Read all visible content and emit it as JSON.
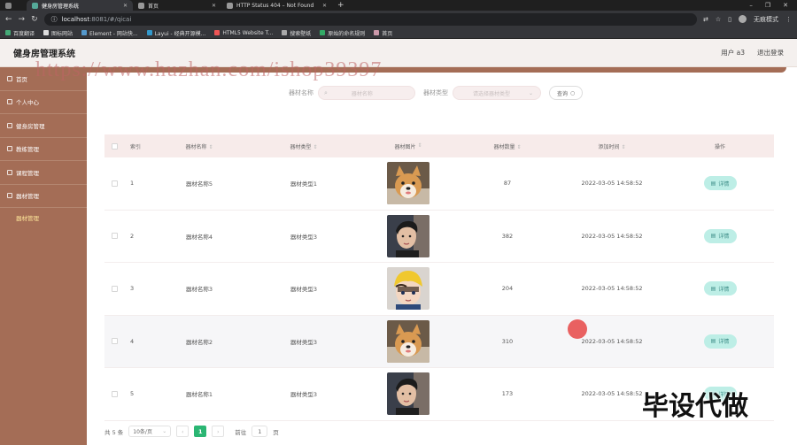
{
  "browser": {
    "tabs": [
      {
        "title": "健身房管理系统"
      },
      {
        "title": "首页"
      },
      {
        "title": "HTTP Status 404 – Not Found"
      }
    ],
    "url_host": "localhost",
    "url_rest": ":8081/#/qicai",
    "profile_label": "无痕模式",
    "bookmarks": [
      "百度翻译",
      "图标网站",
      "Element - 网站快...",
      "Layui - 经典开源模...",
      "HTML5 Website T...",
      "搜索壁纸",
      "原始的命名规则",
      "首页"
    ]
  },
  "header": {
    "title": "健身房管理系统",
    "user": "用户 a3",
    "logout": "退出登录"
  },
  "sidebar": {
    "items": [
      {
        "label": "首页"
      },
      {
        "label": "个人中心"
      },
      {
        "label": "健身房管理"
      },
      {
        "label": "教练管理"
      },
      {
        "label": "课程管理"
      },
      {
        "label": "器材管理"
      }
    ],
    "sub_item": "器材管理"
  },
  "search": {
    "name_label": "器材名称",
    "name_placeholder": "器材名称",
    "type_label": "器材类型",
    "type_placeholder": "请选择器材类型",
    "button": "查询"
  },
  "table": {
    "headers": {
      "index": "索引",
      "name": "器材名称",
      "type": "器材类型",
      "image": "器材图片",
      "count": "器材数量",
      "time": "添加时间",
      "op": "操作"
    },
    "detail_label": "详情",
    "rows": [
      {
        "index": "1",
        "name": "器材名称5",
        "type": "器材类型1",
        "image": "shiba-dog-photo",
        "count": "87",
        "time": "2022-03-05 14:58:52"
      },
      {
        "index": "2",
        "name": "器材名称4",
        "type": "器材类型3",
        "image": "man-portrait-photo",
        "count": "382",
        "time": "2022-03-05 14:58:52"
      },
      {
        "index": "3",
        "name": "器材名称3",
        "type": "器材类型3",
        "image": "cartoon-boy-photo",
        "count": "204",
        "time": "2022-03-05 14:58:52"
      },
      {
        "index": "4",
        "name": "器材名称2",
        "type": "器材类型3",
        "image": "shiba-dog-photo",
        "count": "310",
        "time": "2022-03-05 14:58:52"
      },
      {
        "index": "5",
        "name": "器材名称1",
        "type": "器材类型3",
        "image": "man-portrait-photo",
        "count": "173",
        "time": "2022-03-05 14:58:52"
      }
    ]
  },
  "pagination": {
    "total": "共 5 条",
    "page_size": "10条/页",
    "current": "1",
    "goto_label": "前往",
    "goto_value": "1",
    "page_suffix": "页"
  },
  "overlay": {
    "watermark": "https://www.huzhan.com/ishop39397",
    "corner_logo": "毕设代做"
  },
  "colors": {
    "sidebar": "#a46d56",
    "header": "#f4f0ee",
    "table_head": "#f7ebea",
    "detail_button": "#bdeee6",
    "page_current": "#2bb673"
  }
}
